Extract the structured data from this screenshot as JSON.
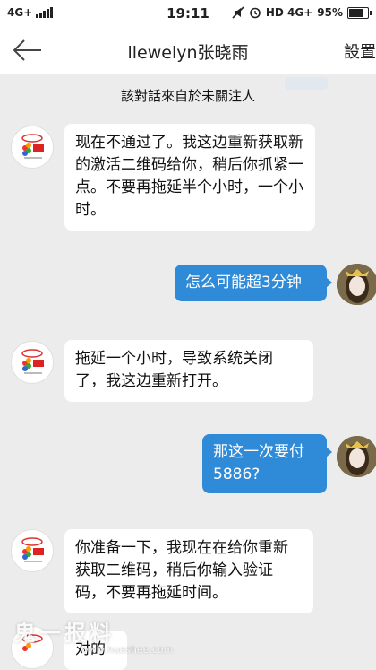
{
  "status_bar": {
    "network": "4G+",
    "time": "19:11",
    "network_right": "HD 4G+",
    "battery": "95%"
  },
  "header": {
    "title": "llewelyn张晓雨",
    "settings_label": "設置"
  },
  "notice": "該對話來自於未關注人",
  "messages": [
    {
      "side": "left",
      "text": "现在不通过了。我这边重新获取新的激活二维码给你，稍后你抓紧一点。不要再拖延半个小时，一个小时。"
    },
    {
      "side": "right",
      "text": "怎么可能超3分钟"
    },
    {
      "side": "left",
      "text": "拖延一个小时，导致系统关闭了，我这边重新打开。"
    },
    {
      "side": "right",
      "text": "那这一次要付5886?"
    },
    {
      "side": "left",
      "text": "你准备一下，我现在在给你重新获取二维码，稍后你输入验证码，不要再拖延时间。"
    },
    {
      "side": "left",
      "text": "对的"
    }
  ],
  "watermark": "鬼一报料",
  "watermark_url": "www.huoshee.com",
  "colors": {
    "bubble_right": "#2f8bd8",
    "bubble_left": "#ffffff",
    "background": "#ececec"
  }
}
